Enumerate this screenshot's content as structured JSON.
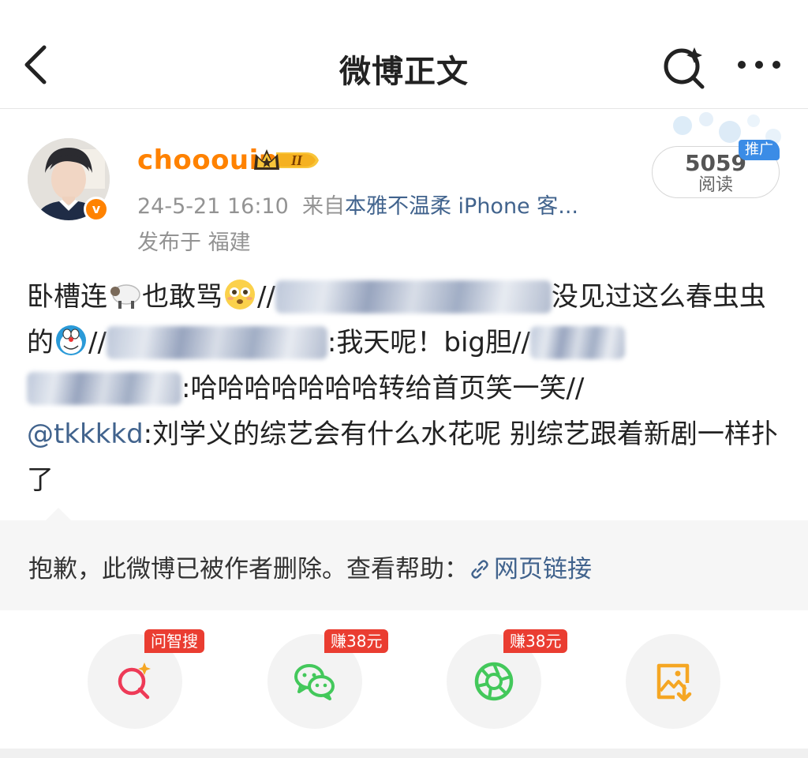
{
  "navbar": {
    "title": "微博正文"
  },
  "post": {
    "username": "chooouin",
    "vip_level": "II",
    "verified_mark": "v",
    "time": "24-5-21 16:10",
    "source_prefix": "来自",
    "source": "本雅不温柔 iPhone 客...",
    "location": "发布于 福建",
    "read_count": "5059",
    "read_label": "阅读",
    "promo_tag": "推广",
    "content": {
      "seg1": "卧槽连",
      "seg2": "也敢骂",
      "seg3": "//",
      "seg4": "没见过这么春虫虫的",
      "seg5": "//",
      "seg6": ":我天呢！big胆//",
      "seg7": ":哈哈哈哈哈哈哈转给首页笑一笑//",
      "mention": "@tkkkkd",
      "seg8": ":刘学义的综艺会有什么水花呢 别综艺跟着新剧一样扑了"
    }
  },
  "deleted_notice": {
    "text": "抱歉，此微博已被作者删除。查看帮助：",
    "link": "网页链接"
  },
  "actions": [
    {
      "icon": "ai-search-icon",
      "tag": "问智搜"
    },
    {
      "icon": "wechat-icon",
      "tag": "赚38元"
    },
    {
      "icon": "moments-icon",
      "tag": "赚38元"
    },
    {
      "icon": "save-image-icon",
      "tag": ""
    }
  ],
  "colors": {
    "username": "#ff8200",
    "link": "#41638d",
    "meta": "#939393",
    "tag_red": "#ea3d31",
    "wechat_green": "#43c85b",
    "save_orange": "#f5a623"
  }
}
